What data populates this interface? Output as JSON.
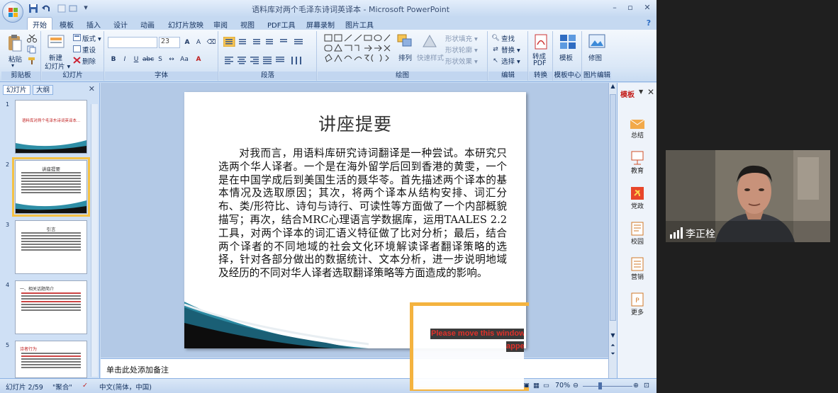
{
  "window": {
    "title": "语料库对两个毛泽东诗词英译本 - Microsoft PowerPoint",
    "controls": [
      "–",
      "▫",
      "✕"
    ]
  },
  "ribbon": {
    "tabs": [
      "开始",
      "模板",
      "插入",
      "设计",
      "动画",
      "幻灯片放映",
      "审阅",
      "视图",
      "PDF工具",
      "屏幕录制",
      "图片工具"
    ],
    "active_tab": "开始",
    "groups": {
      "clipboard": {
        "label": "剪贴板",
        "paste": "粘贴"
      },
      "slides": {
        "label": "幻灯片",
        "new_slide_1": "新建",
        "new_slide_2": "幻灯片 ▾",
        "layout": "版式 ▾",
        "reset": "重设",
        "delete": "删除"
      },
      "font": {
        "label": "字体",
        "font_name": "",
        "font_size": "23"
      },
      "paragraph": {
        "label": "段落"
      },
      "drawing": {
        "label": "绘图",
        "arrange": "排列",
        "quick_styles": "快速样式",
        "shape_fill": "形状填充 ▾",
        "shape_outline": "形状轮廓 ▾",
        "shape_effects": "形状效果 ▾"
      },
      "editing": {
        "label": "编辑",
        "find": "查找",
        "replace": "替换 ▾",
        "select": "选择 ▾"
      },
      "convert": {
        "label": "转换",
        "to_pdf_1": "转成",
        "to_pdf_2": "PDF"
      },
      "template_center": {
        "label": "模板中心",
        "template": "模板"
      },
      "image_edit": {
        "label": "图片编辑",
        "retouch": "修图"
      }
    }
  },
  "left_pane": {
    "tabs": [
      "幻灯片",
      "大纲"
    ],
    "close": "✕",
    "thumbnails": [
      {
        "num": "1",
        "title": "语料库对两个毛泽东诗词英译本..."
      },
      {
        "num": "2",
        "title": "讲座提要"
      },
      {
        "num": "3",
        "title": "引言"
      },
      {
        "num": "4",
        "title": "一、相关话题简介"
      },
      {
        "num": "5",
        "title": "诗者行为"
      }
    ]
  },
  "slide": {
    "title": "讲座提要",
    "body": "对我而言，用语料库研究诗词翻译是一种尝试。本研究只选两个华人译者。一个是在海外留学后回到香港的黄雯，一个是在中国学成后到美国生活的聂华苓。首先描述两个译本的基本情况及选取原因；其次，将两个译本从结构安排、词汇分布、类/形符比、诗句与诗行、可读性等方面做了一个内部概貌描写；再次，结合MRC心理语言学数据库，运用TAALES 2.2工具，对两个译本的词汇语义特征做了比对分析；最后，结合两个译者的不同地域的社会文化环境解读译者翻译策略的选择，针对各部分做出的数据统计、文本分析，进一步说明地域及经历的不同对华人译者选取翻译策略等方面造成的影响。"
  },
  "notes": {
    "placeholder": "单击此处添加备注"
  },
  "task_pane": {
    "title": "模板",
    "items": [
      "总结",
      "教育",
      "党政",
      "校园",
      "营销",
      "更多"
    ]
  },
  "status_bar": {
    "slide_pos": "幻灯片 2/59",
    "theme": "\"聚合\"",
    "language": "中文(简体，中国)",
    "zoom": "70%"
  },
  "overlay": {
    "message_line1": "Please move this window",
    "message_line2": "appear"
  },
  "webcam": {
    "name": "李正栓"
  }
}
